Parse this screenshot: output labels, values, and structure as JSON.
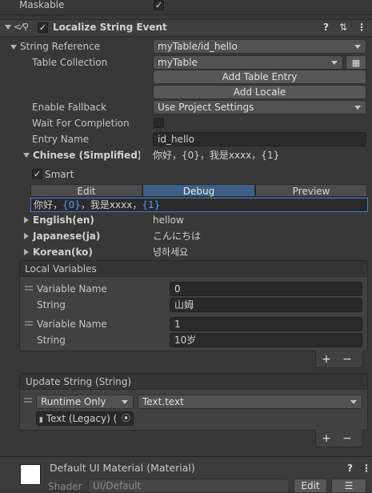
{
  "top": {
    "maskable_label": "Maskable",
    "maskable_checked": "✓"
  },
  "component": {
    "title": "Localize String Event",
    "checked": "✓",
    "icons": [
      "help-icon",
      "preset-icon",
      "menu-icon"
    ]
  },
  "string_reference": {
    "label": "String Reference",
    "value": "myTable/id_hello",
    "table_collection_label": "Table Collection",
    "table_collection_value": "myTable",
    "add_table_entry": "Add Table Entry",
    "add_locale": "Add Locale",
    "enable_fallback_label": "Enable Fallback",
    "enable_fallback_value": "Use Project Settings",
    "wait_label": "Wait For Completion",
    "entry_name_label": "Entry Name",
    "entry_name_value": "id_hello"
  },
  "locales": {
    "chinese_label": "Chinese (Simplified)(zl",
    "chinese_preview": "你好，{0}，我是xxxx，{1}",
    "smart_label": "Smart",
    "smart_checked": "✓",
    "tabs": [
      "Edit",
      "Debug",
      "Preview"
    ],
    "debug_text_parts": [
      "你好，",
      "{0}",
      "，我是xxxx，",
      "{1}"
    ],
    "english_label": "English(en)",
    "english_value": "hellow",
    "japanese_label": "Japanese(ja)",
    "japanese_value": "こんにちは",
    "korean_label": "Korean(ko)",
    "korean_value": "녕하세요"
  },
  "local_variables": {
    "title": "Local Variables",
    "items": [
      {
        "name_label": "Variable Name",
        "name_value": "0",
        "type_label": "String",
        "type_value": "山姆"
      },
      {
        "name_label": "Variable Name",
        "name_value": "1",
        "type_label": "String",
        "type_value": "10岁"
      }
    ],
    "add_symbol": "+",
    "remove_symbol": "−"
  },
  "update_string": {
    "title": "Update String (String)",
    "runtime_value": "Runtime Only",
    "function_value": "Text.text",
    "object_value": "Text (Legacy) (",
    "add_symbol": "+",
    "remove_symbol": "−"
  },
  "material": {
    "title": "Default UI Material (Material)",
    "shader_label": "Shader",
    "shader_value": "UI/Default",
    "edit_label": "Edit"
  },
  "colors": {
    "accent_blue": "#3e5f86",
    "brace_blue": "#4aa0ff",
    "panel": "#383838"
  }
}
